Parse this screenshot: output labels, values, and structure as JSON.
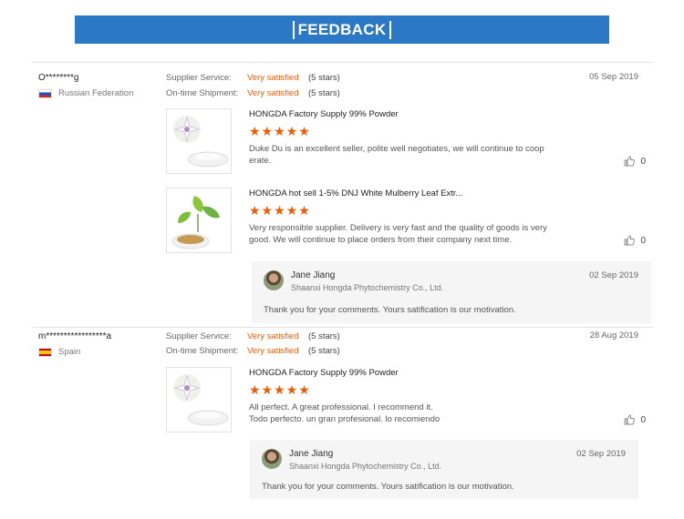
{
  "header": {
    "title": "FEEDBACK"
  },
  "reviews": [
    {
      "buyer": "O********g",
      "country": "Russian Federation",
      "supplier_service_label": "Supplier Service:",
      "supplier_service_value": "Very satisfied",
      "supplier_service_stars": "(5 stars)",
      "shipment_label": "On-time Shipment:",
      "shipment_value": "Very satisfied",
      "shipment_stars": "(5 stars)",
      "date": "05 Sep 2019",
      "items": [
        {
          "product": "HONGDA Factory Supply 99% Powder",
          "stars": "★★★★★",
          "comment": "Duke Du is an excellent seller, polite well negotiates, we will continue to coop erate.",
          "likes": "0"
        },
        {
          "product": "HONGDA hot sell 1-5% DNJ White Mulberry Leaf Extr...",
          "stars": "★★★★★",
          "comment": "Very responsible supplier. Delivery is very fast and the quality of goods is very good. We will continue to place orders from their company next time.",
          "likes": "0"
        }
      ],
      "reply": {
        "name": "Jane Jiang",
        "company": "Shaanxi Hongda Phytochemistry Co., Ltd.",
        "date": "02 Sep 2019",
        "text": "Thank you for your comments. Yours satification is our motivation."
      }
    },
    {
      "buyer": "m*****************a",
      "country": "Spain",
      "supplier_service_label": "Supplier Service:",
      "supplier_service_value": "Very satisfied",
      "supplier_service_stars": "(5 stars)",
      "shipment_label": "On-time Shipment:",
      "shipment_value": "Very satisfied",
      "shipment_stars": "(5 stars)",
      "date": "28 Aug 2019",
      "items": [
        {
          "product": "HONGDA Factory Supply 99% Powder",
          "stars": "★★★★★",
          "comment": "All perfect.  A great professional.  I recommend it.\nTodo perfecto. un gran profesional. lo recomiendo",
          "likes": "0"
        }
      ],
      "reply": {
        "name": "Jane Jiang",
        "company": "Shaanxi Hongda Phytochemistry Co., Ltd.",
        "date": "02 Sep 2019",
        "text": "Thank you for your comments. Yours satification is our motivation."
      }
    }
  ]
}
